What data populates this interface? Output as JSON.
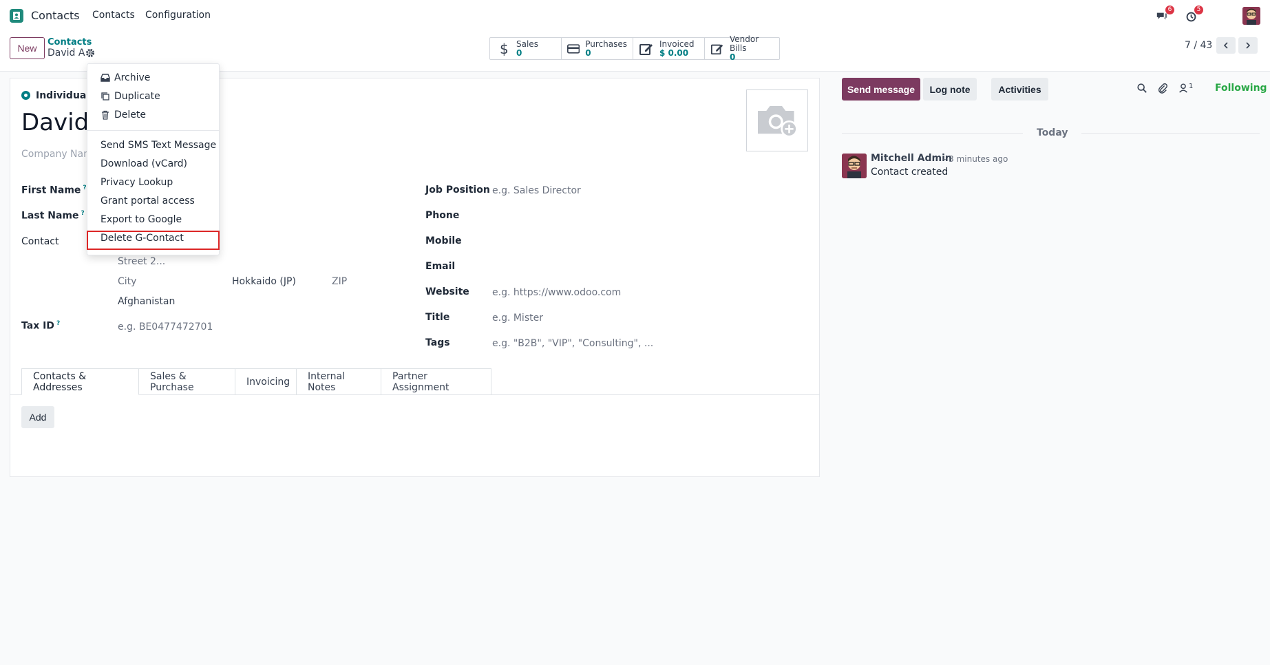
{
  "topbar": {
    "app_name": "Contacts",
    "menu": [
      "Contacts",
      "Configuration"
    ],
    "messages_badge": "6",
    "activities_badge": "5"
  },
  "control_panel": {
    "new_label": "New",
    "breadcrumb_parent": "Contacts",
    "breadcrumb_current": "David A",
    "stats": [
      {
        "label": "Sales",
        "value": "0",
        "icon": "dollar-icon"
      },
      {
        "label": "Purchases",
        "value": "0",
        "icon": "credit-card-icon"
      },
      {
        "label": "Invoiced",
        "value": "$ 0.00",
        "icon": "pencil-square-icon"
      },
      {
        "label": "Vendor Bills",
        "value": "0",
        "icon": "pencil-square-icon"
      }
    ],
    "pager": "7 / 43"
  },
  "form": {
    "company_type": "Individual",
    "name": "David A",
    "company_name_placeholder": "Company Name...",
    "first_name_label": "First Name",
    "last_name_label": "Last Name",
    "contact_label": "Contact",
    "street2_placeholder": "Street 2...",
    "city_placeholder": "City",
    "state_value": "Hokkaido (JP)",
    "zip_placeholder": "ZIP",
    "country_value": "Afghanistan",
    "tax_id_label": "Tax ID",
    "tax_id_placeholder": "e.g. BE0477472701",
    "job_position_label": "Job Position",
    "job_position_placeholder": "e.g. Sales Director",
    "phone_label": "Phone",
    "mobile_label": "Mobile",
    "email_label": "Email",
    "website_label": "Website",
    "website_placeholder": "e.g. https://www.odoo.com",
    "title_label": "Title",
    "title_placeholder": "e.g. Mister",
    "tags_label": "Tags",
    "tags_placeholder": "e.g. \"B2B\", \"VIP\", \"Consulting\", ...",
    "tabs": [
      "Contacts & Addresses",
      "Sales & Purchase",
      "Invoicing",
      "Internal Notes",
      "Partner Assignment"
    ],
    "add_label": "Add"
  },
  "dropdown": {
    "items_top": [
      {
        "label": "Archive",
        "icon": "archive-icon"
      },
      {
        "label": "Duplicate",
        "icon": "copy-icon"
      },
      {
        "label": "Delete",
        "icon": "trash-icon"
      }
    ],
    "items_bottom": [
      "Send SMS Text Message",
      "Download (vCard)",
      "Privacy Lookup",
      "Grant portal access",
      "Export to Google",
      "Delete G-Contact"
    ]
  },
  "chatter": {
    "send_message": "Send message",
    "log_note": "Log note",
    "activities": "Activities",
    "followers_count": "1",
    "following": "Following",
    "today": "Today",
    "message": {
      "author": "Mitchell Admin",
      "time": "- 3 minutes ago",
      "body": "Contact created"
    }
  }
}
